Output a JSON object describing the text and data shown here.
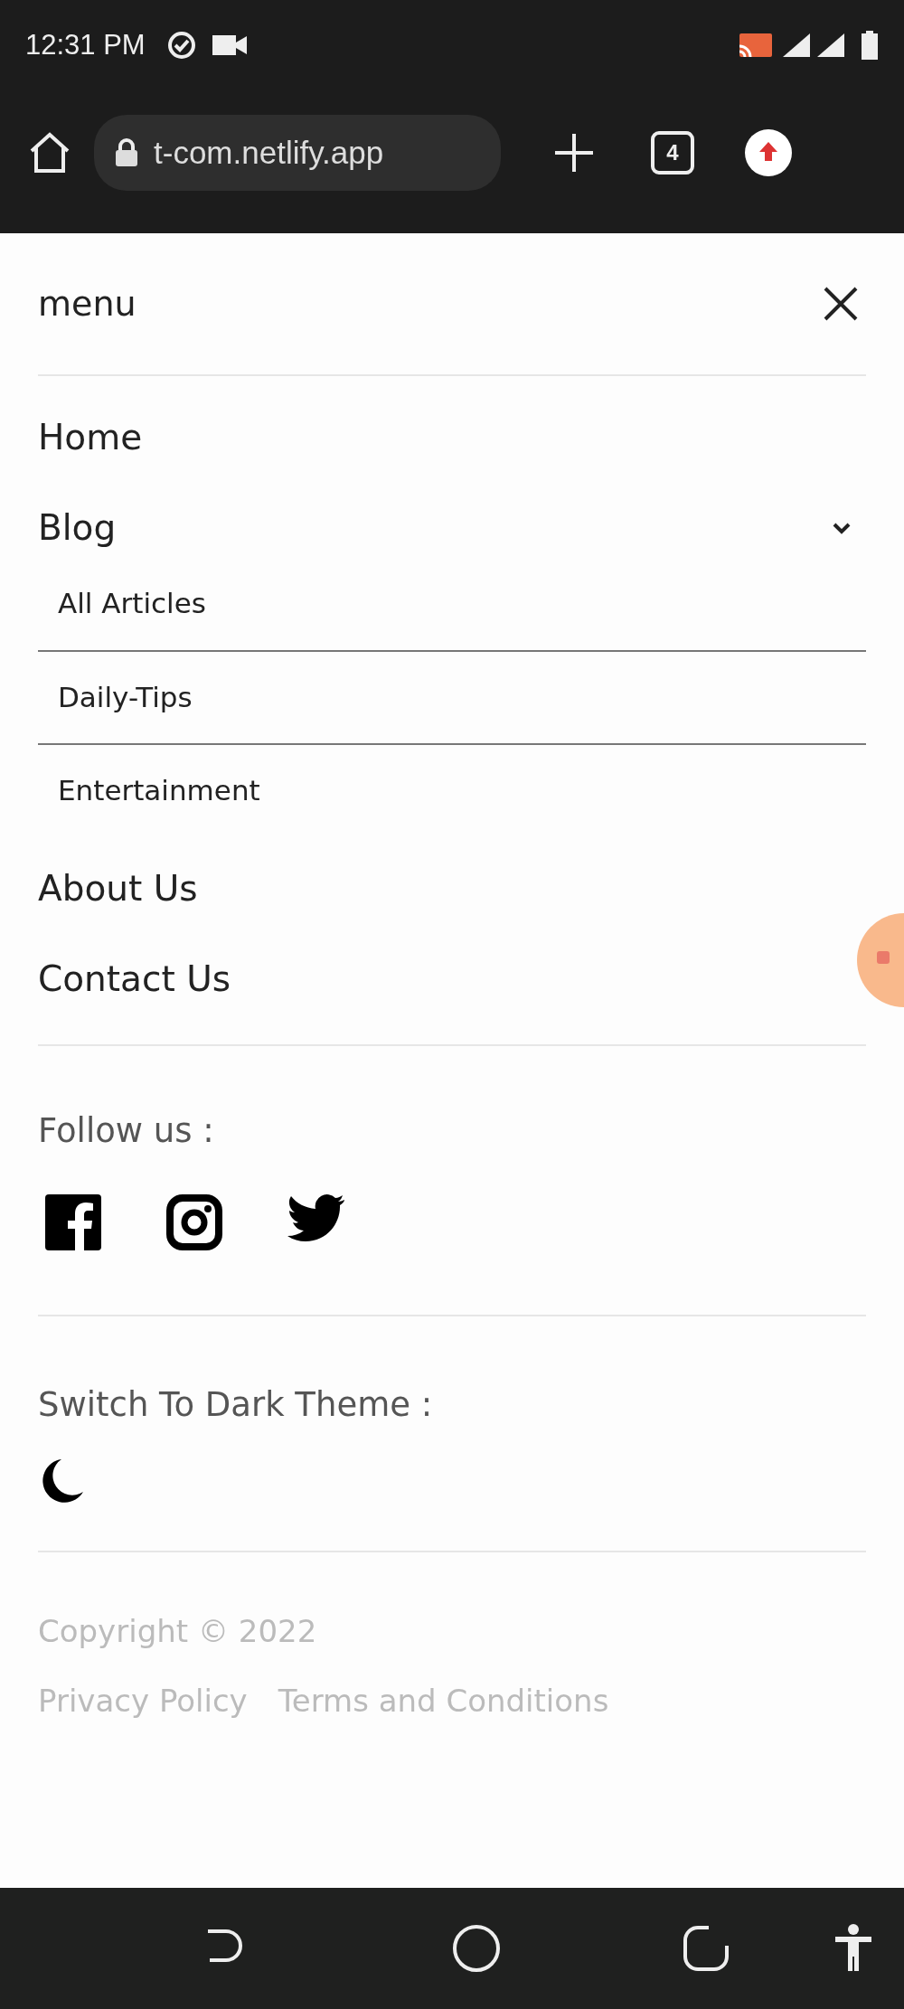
{
  "status_bar": {
    "time": "12:31 PM"
  },
  "browser": {
    "url": "t-com.netlify.app",
    "tab_count": "4"
  },
  "menu": {
    "title": "menu",
    "items": [
      {
        "label": "Home"
      },
      {
        "label": "Blog",
        "expanded": true,
        "children": [
          {
            "label": "All Articles"
          },
          {
            "label": "Daily-Tips"
          },
          {
            "label": "Entertainment"
          }
        ]
      },
      {
        "label": "About Us"
      },
      {
        "label": "Contact Us"
      }
    ],
    "follow_label": "Follow us :",
    "theme_label": "Switch To Dark Theme :",
    "copyright": "Copyright © 2022",
    "footer_links": [
      "Privacy Policy",
      "Terms and Conditions"
    ]
  }
}
